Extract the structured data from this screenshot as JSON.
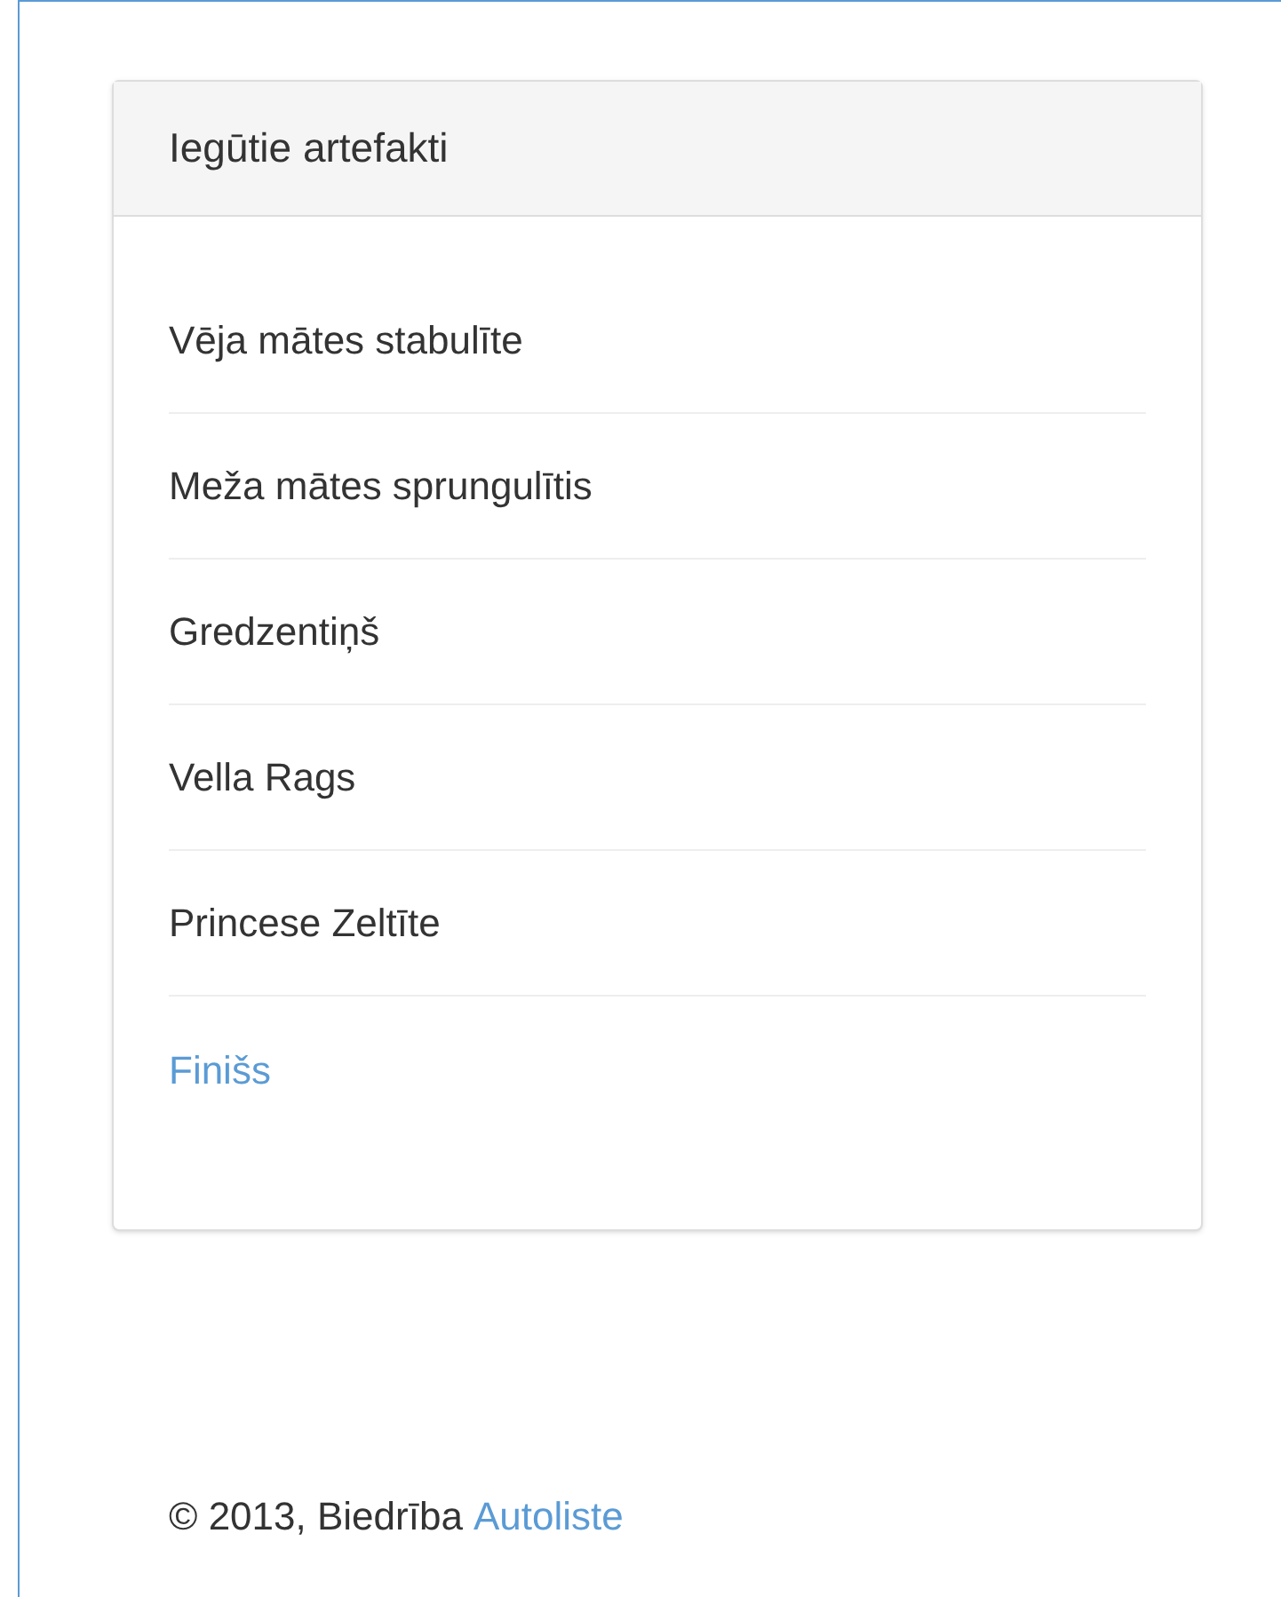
{
  "panel": {
    "title": "Iegūtie artefakti",
    "items": [
      {
        "label": "Vēja mātes stabulīte",
        "kind": "text"
      },
      {
        "label": "Meža mātes sprungulītis",
        "kind": "text"
      },
      {
        "label": "Gredzentiņš",
        "kind": "text"
      },
      {
        "label": "Vella Rags",
        "kind": "text"
      },
      {
        "label": "Princese Zeltīte",
        "kind": "text"
      },
      {
        "label": "Finišs",
        "kind": "link"
      }
    ]
  },
  "footer": {
    "text": "© 2013, Biedrība",
    "link": "Autoliste"
  }
}
